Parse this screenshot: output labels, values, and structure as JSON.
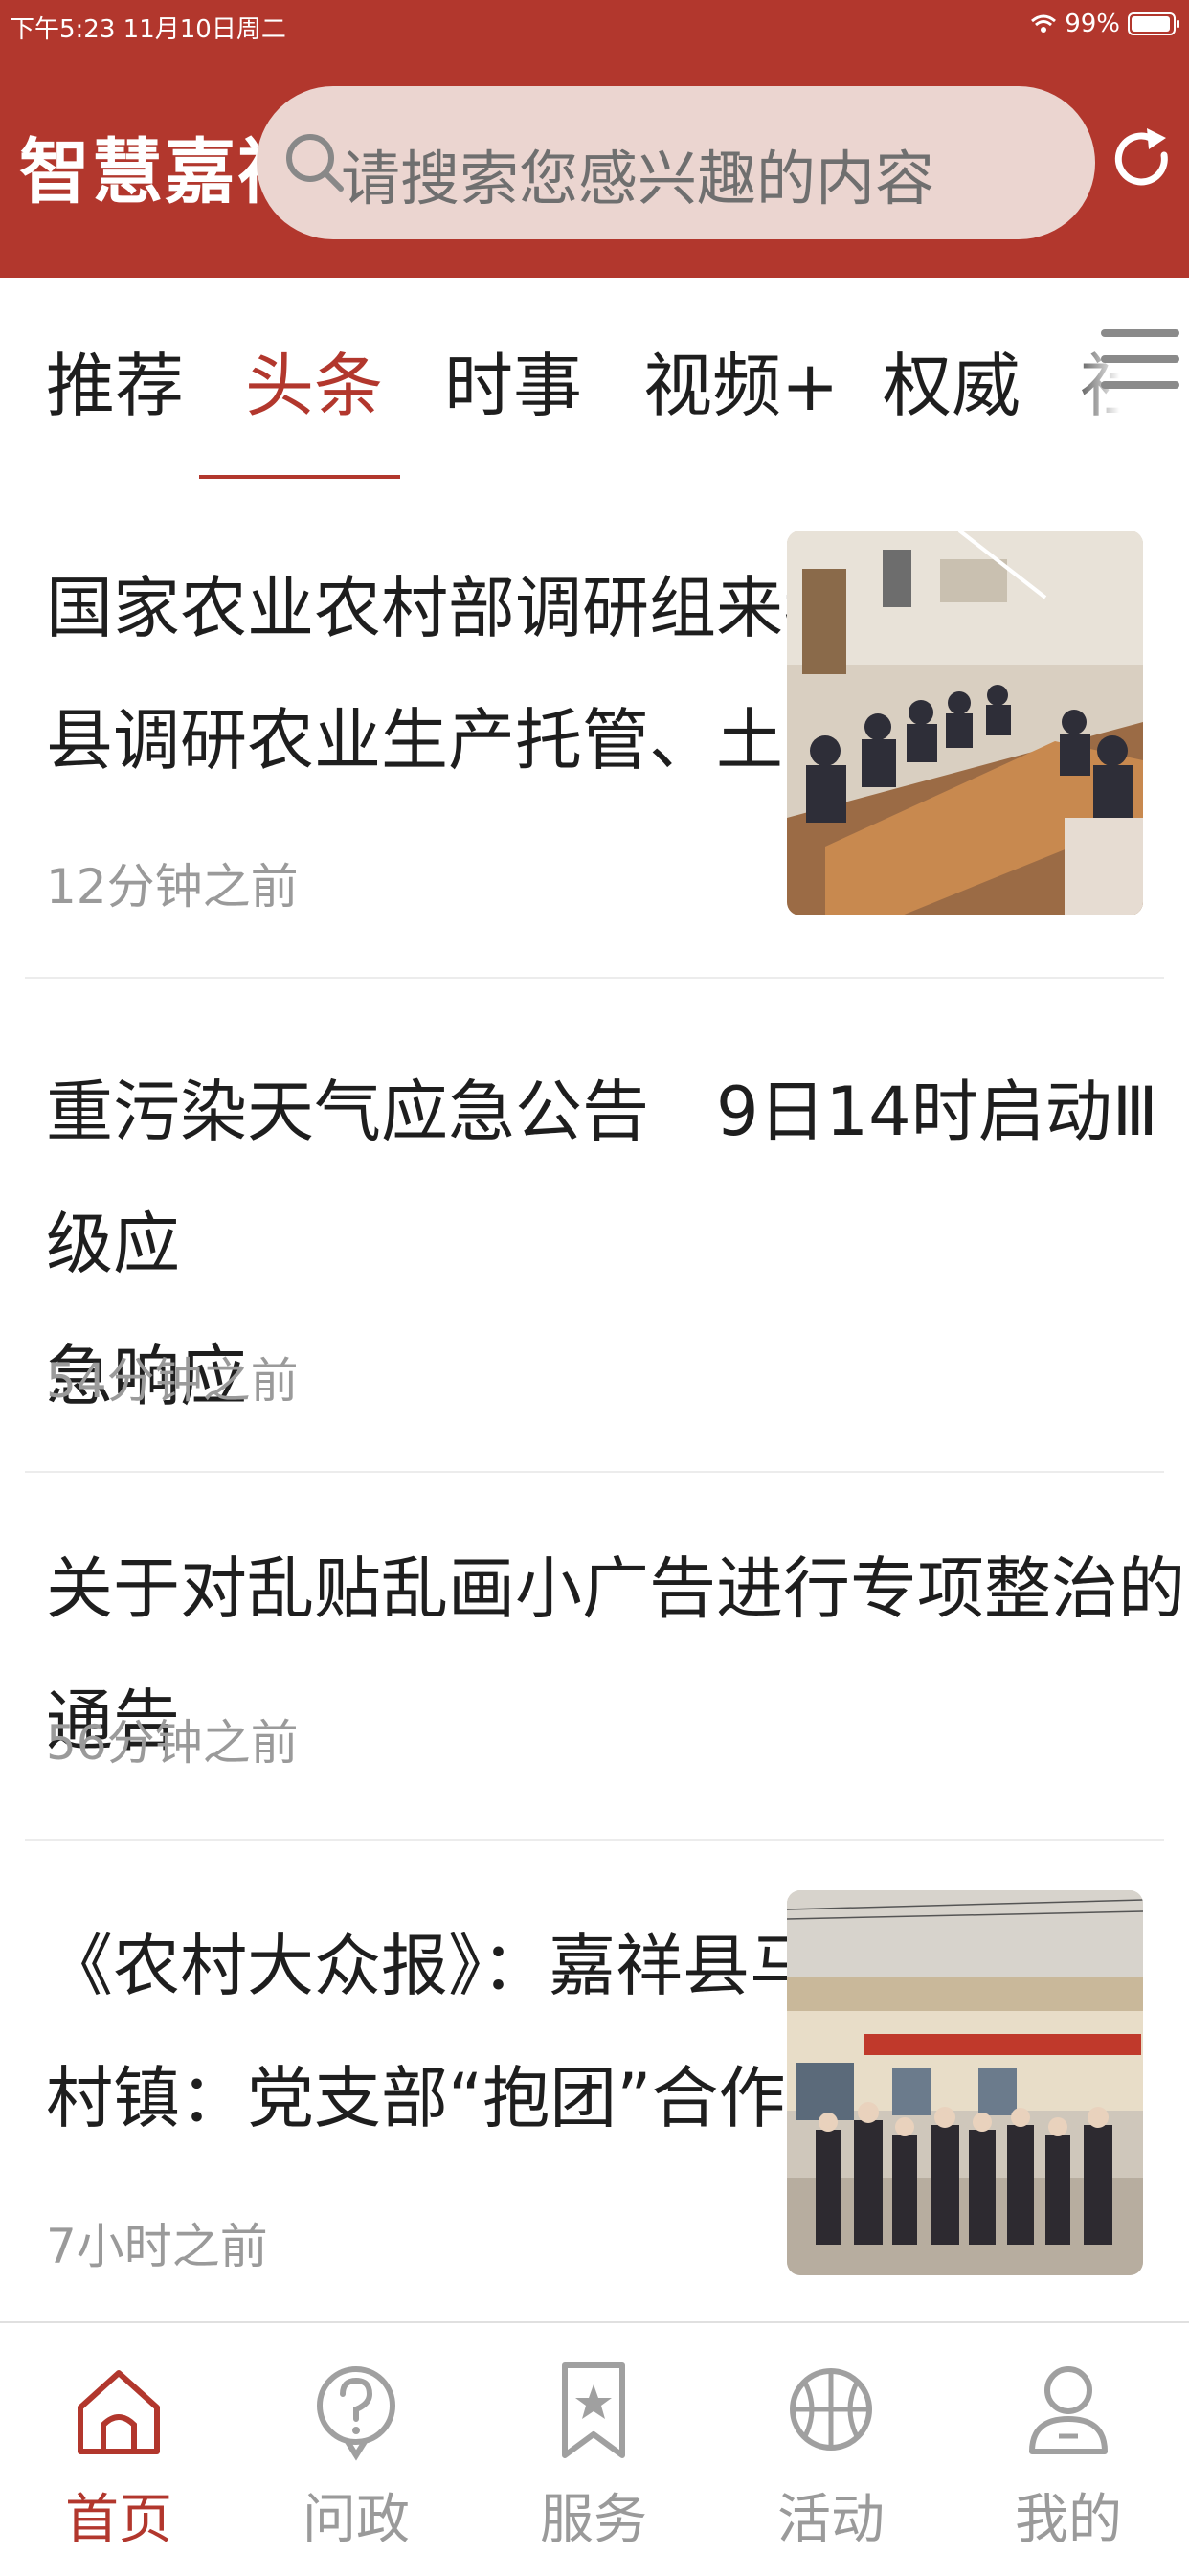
{
  "status_bar": {
    "time_date": "下午5:23   11月10日周二",
    "battery": "99%"
  },
  "header": {
    "logo": "智慧嘉祥",
    "search_placeholder": "请搜索您感兴趣的内容"
  },
  "tabs": [
    {
      "label": "推荐",
      "active": false
    },
    {
      "label": "头条",
      "active": true
    },
    {
      "label": "时事",
      "active": false
    },
    {
      "label": "视频+",
      "active": false
    },
    {
      "label": "权威",
      "active": false
    },
    {
      "label": "社",
      "active": false
    }
  ],
  "news": [
    {
      "title_line1": "国家农业农村部调研组来我",
      "title_line2": "县调研农业生产托管、土…",
      "time": "12分钟之前",
      "has_image": true
    },
    {
      "title_line1": "重污染天气应急公告　9日14时启动Ⅲ级应",
      "title_line2": "急响应",
      "time": "54分钟之前",
      "has_image": false
    },
    {
      "title_line1": "关于对乱贴乱画小广告进行专项整治的通告",
      "time": "56分钟之前",
      "has_image": false
    },
    {
      "title_line1": "《农村大众报》：嘉祥县马",
      "title_line2": "村镇：党支部“抱团”合作…",
      "time": "7小时之前",
      "has_image": true
    }
  ],
  "bottom_nav": [
    {
      "label": "首页",
      "icon": "home-icon",
      "active": true
    },
    {
      "label": "问政",
      "icon": "question-icon",
      "active": false
    },
    {
      "label": "服务",
      "icon": "bookmark-star-icon",
      "active": false
    },
    {
      "label": "活动",
      "icon": "basketball-icon",
      "active": false
    },
    {
      "label": "我的",
      "icon": "user-icon",
      "active": false
    }
  ],
  "colors": {
    "brand": "#b2372d",
    "search_bg": "#ebd5d0",
    "muted": "#9a9a9a"
  }
}
